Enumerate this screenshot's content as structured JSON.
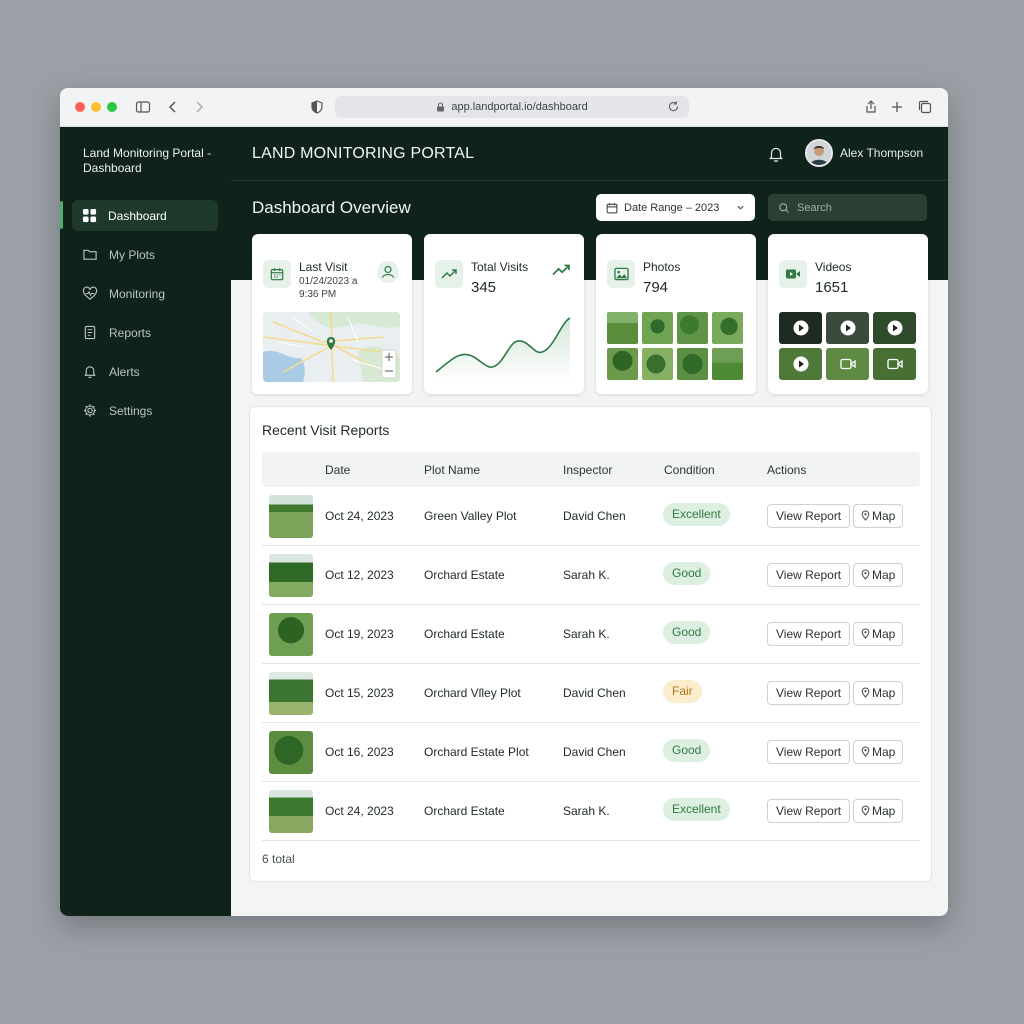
{
  "browser": {
    "url": "app.landportal.io/dashboard",
    "traffic_colors": [
      "#ff5f57",
      "#febc2e",
      "#28c840"
    ]
  },
  "sidebar": {
    "brand": "Land Monitoring Portal - Dashboard",
    "items": [
      {
        "label": "Dashboard",
        "icon": "grid-icon",
        "active": true
      },
      {
        "label": "My Plots",
        "icon": "folder-icon"
      },
      {
        "label": "Monitoring",
        "icon": "heart-pulse-icon"
      },
      {
        "label": "Reports",
        "icon": "report-icon"
      },
      {
        "label": "Alerts",
        "icon": "bell-icon"
      },
      {
        "label": "Settings",
        "icon": "gear-icon"
      }
    ]
  },
  "header": {
    "title": "LAND MONITORING PORTAL",
    "user_name": "Alex Thompson"
  },
  "overview": {
    "title": "Dashboard Overview",
    "date_range": "Date Range – 2023",
    "search_placeholder": "Search"
  },
  "cards": {
    "last_visit": {
      "title": "Last Visit",
      "value": "01/24/2023 a 9:36 PM"
    },
    "total_visits": {
      "title": "Total Visits",
      "value": "345"
    },
    "photos": {
      "title": "Photos",
      "value": "794"
    },
    "videos": {
      "title": "Videos",
      "value": "1651"
    }
  },
  "reports": {
    "title": "Recent Visit Reports",
    "columns": [
      "Date",
      "Plot Name",
      "Inspector",
      "Condition",
      "Actions"
    ],
    "view_label": "View Report",
    "map_label": "Map",
    "rows": [
      {
        "date": "Oct 24, 2023",
        "plot": "Green Valley Plot",
        "inspector": "David Chen",
        "condition": "Excellent",
        "status": "good"
      },
      {
        "date": "Oct 12, 2023",
        "plot": "Orchard Estate",
        "inspector": "Sarah K.",
        "condition": "Good",
        "status": "good"
      },
      {
        "date": "Oct 19, 2023",
        "plot": "Orchard Estate",
        "inspector": "Sarah K.",
        "condition": "Good",
        "status": "good"
      },
      {
        "date": "Oct 15, 2023",
        "plot": "Orchard Vſley Plot",
        "inspector": "David Chen",
        "condition": "Fair",
        "status": "fair"
      },
      {
        "date": "Oct 16, 2023",
        "plot": "Orchard Estate Plot",
        "inspector": "David Chen",
        "condition": "Good",
        "status": "good"
      },
      {
        "date": "Oct 24, 2023",
        "plot": "Orchard Estate",
        "inspector": "Sarah K.",
        "condition": "Excellent",
        "status": "good"
      }
    ],
    "total_label": "6 total"
  },
  "colors": {
    "sidebar_bg": "#0f231a",
    "accent": "#4caf6a",
    "badge_good": "#dcefe1",
    "badge_fair": "#fbeccb"
  }
}
